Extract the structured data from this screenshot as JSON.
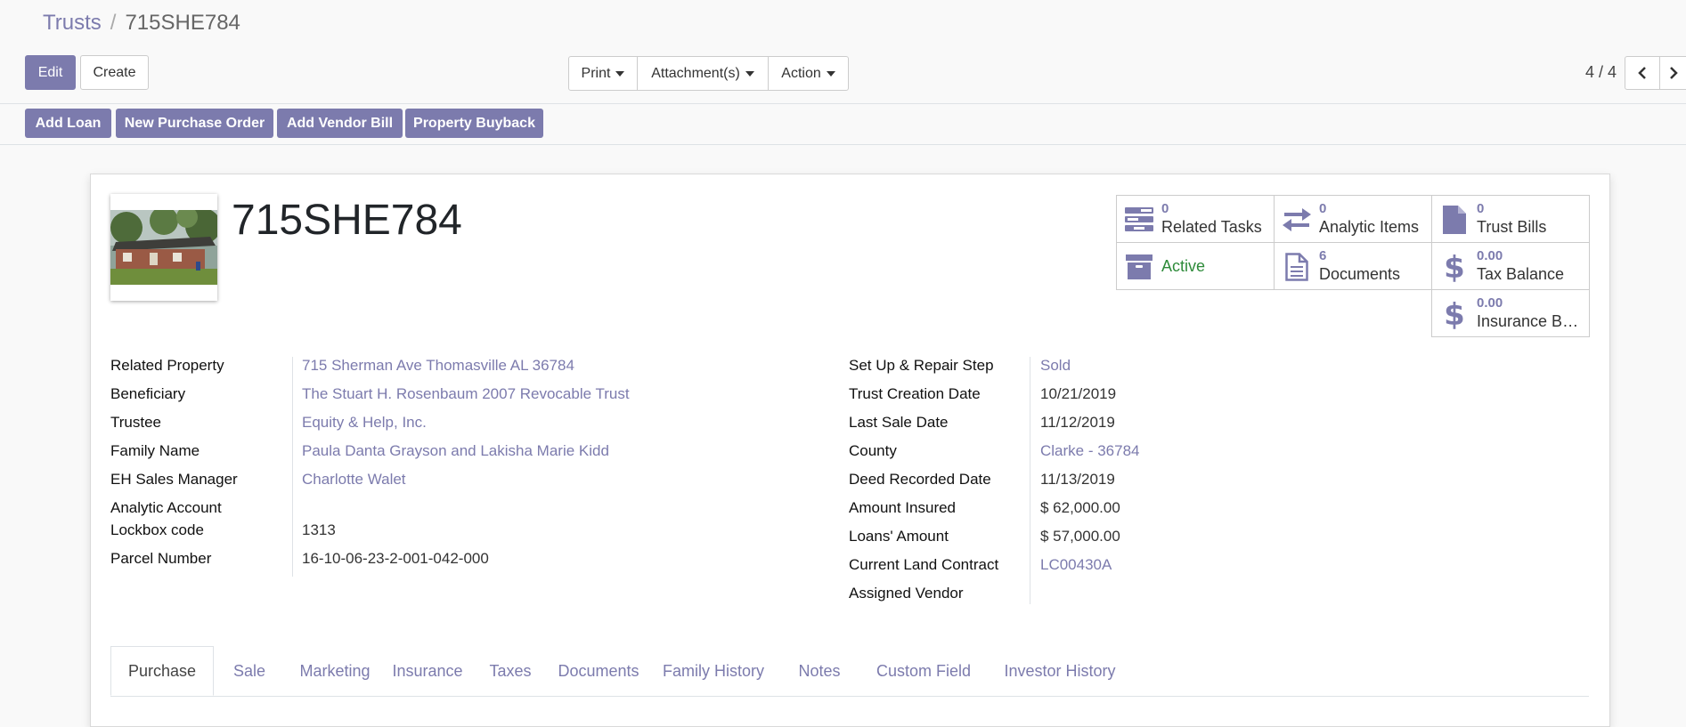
{
  "breadcrumb": {
    "parent": "Trusts",
    "separator": "/",
    "current": "715SHE784"
  },
  "toolbar": {
    "edit_label": "Edit",
    "create_label": "Create",
    "print_label": "Print",
    "attachments_label": "Attachment(s)",
    "action_label": "Action"
  },
  "pager": {
    "value": "4 / 4"
  },
  "statusbar": {
    "add_loan": "Add Loan",
    "new_purchase_order": "New Purchase Order",
    "add_vendor_bill": "Add Vendor Bill",
    "property_buyback": "Property Buyback"
  },
  "record": {
    "title": "715SHE784"
  },
  "smart_buttons": {
    "related_tasks": {
      "value": "0",
      "label": "Related Tasks",
      "icon": "tasks-icon"
    },
    "analytic_items": {
      "value": "0",
      "label": "Analytic Items",
      "icon": "exchange-icon"
    },
    "trust_bills": {
      "value": "0",
      "label": "Trust Bills",
      "icon": "file-icon"
    },
    "active": {
      "label": "Active",
      "icon": "archive-icon"
    },
    "documents": {
      "value": "6",
      "label": "Documents",
      "icon": "document-icon"
    },
    "tax_balance": {
      "value": "0.00",
      "label": "Tax Balance",
      "icon": "dollar-icon"
    },
    "insurance_balance": {
      "value": "0.00",
      "label": "Insurance Bal...",
      "icon": "dollar-icon"
    }
  },
  "left_fields": [
    {
      "label": "Related Property",
      "value": "715 Sherman Ave Thomasville AL 36784"
    },
    {
      "label": "Beneficiary",
      "value": "The Stuart H. Rosenbaum 2007 Revocable Trust"
    },
    {
      "label": "Trustee",
      "value": "Equity & Help, Inc."
    },
    {
      "label": "Family Name",
      "value": "Paula Danta Grayson and Lakisha Marie Kidd"
    },
    {
      "label": "EH Sales Manager",
      "value": "Charlotte Walet"
    },
    {
      "label": "Analytic Account",
      "value": ""
    },
    {
      "label": "Lockbox code",
      "value": "1313"
    },
    {
      "label": "Parcel Number",
      "value": "16-10-06-23-2-001-042-000"
    }
  ],
  "right_fields": [
    {
      "label": "Set Up & Repair Step",
      "value": "Sold"
    },
    {
      "label": "Trust Creation Date",
      "value": "10/21/2019"
    },
    {
      "label": "Last Sale Date",
      "value": "11/12/2019"
    },
    {
      "label": "County",
      "value": "Clarke - 36784"
    },
    {
      "label": "Deed Recorded Date",
      "value": "11/13/2019"
    },
    {
      "label": "Amount Insured",
      "value": "$ 62,000.00"
    },
    {
      "label": "Loans' Amount",
      "value": "$ 57,000.00"
    },
    {
      "label": "Current Land Contract",
      "value": "LC00430A"
    },
    {
      "label": "Assigned Vendor",
      "value": ""
    }
  ],
  "tabs": [
    {
      "label": "Purchase"
    },
    {
      "label": "Sale"
    },
    {
      "label": "Marketing"
    },
    {
      "label": "Insurance"
    },
    {
      "label": "Taxes"
    },
    {
      "label": "Documents"
    },
    {
      "label": "Family History"
    },
    {
      "label": "Notes"
    },
    {
      "label": "Custom Field"
    },
    {
      "label": "Investor History"
    }
  ],
  "colors": {
    "accent": "#7c7bad",
    "active": "#2e8b3a",
    "text": "#212529"
  }
}
